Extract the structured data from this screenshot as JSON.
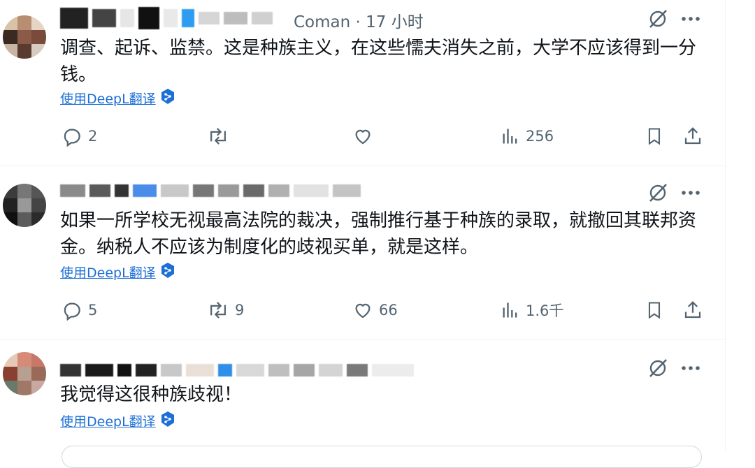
{
  "tweets": [
    {
      "handle_suffix": "Coman · 17 小时",
      "text": "调查、起诉、监禁。这是种族主义，在这些懦夫消失之前，大学不应该得到一分钱。",
      "translate_label": "使用DeepL翻译",
      "stats": {
        "replies": "2",
        "retweets": "",
        "likes": "",
        "views": "256"
      }
    },
    {
      "handle_suffix": "",
      "text": "如果一所学校无视最高法院的裁决，强制推行基于种族的录取，就撤回其联邦资金。纳税人不应该为制度化的歧视买单，就是这样。",
      "translate_label": "使用DeepL翻译",
      "stats": {
        "replies": "5",
        "retweets": "9",
        "likes": "66",
        "views": "1.6千"
      }
    },
    {
      "handle_suffix": "",
      "text": "我觉得这很种族歧视！",
      "translate_label": "使用DeepL翻译",
      "stats": {
        "replies": "",
        "retweets": "",
        "likes": "",
        "views": ""
      }
    }
  ],
  "icons": {
    "grok": "grok-icon",
    "more": "more-icon",
    "reply": "reply-icon",
    "retweet": "retweet-icon",
    "like": "like-icon",
    "views": "views-icon",
    "bookmark": "bookmark-icon",
    "share": "share-icon",
    "translate": "deepl-icon"
  },
  "colors": {
    "text": "#0f1419",
    "secondary": "#536471",
    "link": "#1d6fd6",
    "divider": "#eff3f4"
  }
}
